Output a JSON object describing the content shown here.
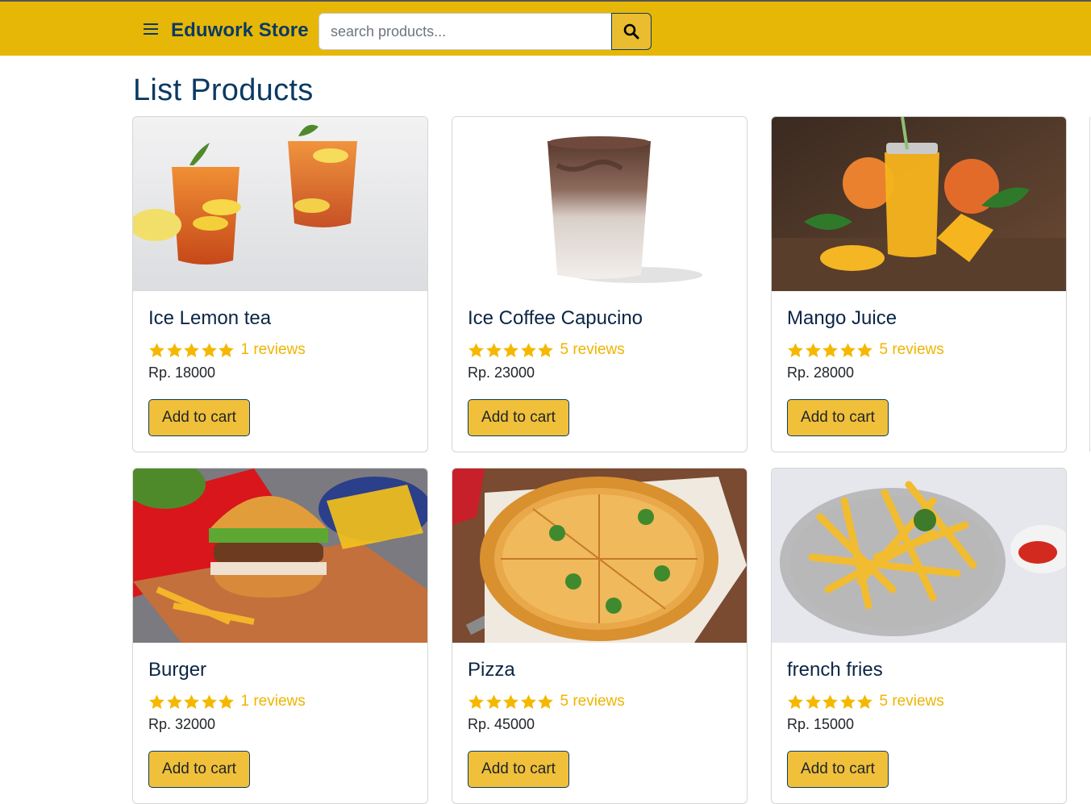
{
  "header": {
    "brand": "Eduwork Store",
    "menu_icon": "hamburger-menu-icon",
    "search": {
      "placeholder": "search products...",
      "value": "",
      "button_icon": "search-icon"
    },
    "background_color": "#e6b707"
  },
  "main": {
    "title": "List Products",
    "products": [
      {
        "name": "Ice Lemon tea",
        "rating": 5,
        "reviews": "1 reviews",
        "price": "Rp. 18000",
        "button": "Add to cart"
      },
      {
        "name": "Ice Coffee Capucino",
        "rating": 5,
        "reviews": "5 reviews",
        "price": "Rp. 23000",
        "button": "Add to cart"
      },
      {
        "name": "Mango Juice",
        "rating": 5,
        "reviews": "5 reviews",
        "price": "Rp. 28000",
        "button": "Add to cart"
      },
      {
        "name": "Burger",
        "rating": 5,
        "reviews": "1 reviews",
        "price": "Rp. 32000",
        "button": "Add to cart"
      },
      {
        "name": "Pizza",
        "rating": 5,
        "reviews": "5 reviews",
        "price": "Rp. 45000",
        "button": "Add to cart"
      },
      {
        "name": "french fries",
        "rating": 5,
        "reviews": "5 reviews",
        "price": "Rp. 15000",
        "button": "Add to cart"
      }
    ]
  },
  "colors": {
    "accent": "#e6b707",
    "button": "#f0c03a",
    "star": "#f5b800",
    "title": "#0b3a63"
  }
}
